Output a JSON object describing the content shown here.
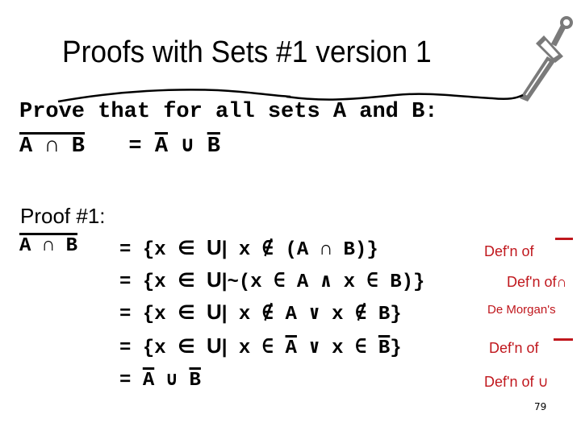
{
  "slide": {
    "title": "Proofs with Sets #1 version 1",
    "sword_icon": "sword-icon",
    "statement_line1": "Prove that for all sets A and B:",
    "statement_line2": {
      "lhs": "A ∩ B",
      "eq": "=",
      "rhs_a": "A",
      "rhs_op": "∪",
      "rhs_b": "B"
    },
    "proof_label": "Proof #1:",
    "proof_lhs": "A ∩ B",
    "steps": [
      {
        "eq": "=",
        "set_open": "{x",
        "elem": "∈",
        "universe": "U",
        "bar": "|",
        "condition": "x ∉ (A ∩ B)}",
        "reason": "Def'n of",
        "reason_symbol": "complement-bar"
      },
      {
        "eq": "=",
        "set_open": "{x",
        "elem": "∈",
        "universe": "U",
        "bar": "|",
        "condition": "~(x ∈ A ∧ x ∈ B)}",
        "reason": "Def'n of",
        "reason_symbol": "∩"
      },
      {
        "eq": "=",
        "set_open": "{x",
        "elem": "∈",
        "universe": "U",
        "bar": "|",
        "condition": "x ∉ A ∨ x ∉ B}",
        "reason": "De Morgan's",
        "reason_symbol": ""
      },
      {
        "eq": "=",
        "set_open": "{x",
        "elem": "∈",
        "universe": "U",
        "bar": "|",
        "condition_pre": "x ∈ ",
        "condition_a": "A",
        "condition_mid": " ∨ x ∈ ",
        "condition_b": "B",
        "condition_end": "}",
        "reason": "Def'n of",
        "reason_symbol": "complement-bar"
      },
      {
        "eq": "=",
        "result_a": "A",
        "result_op": "∪",
        "result_b": "B",
        "reason": "Def'n of",
        "reason_symbol": "∪"
      }
    ],
    "page_number": "79"
  }
}
